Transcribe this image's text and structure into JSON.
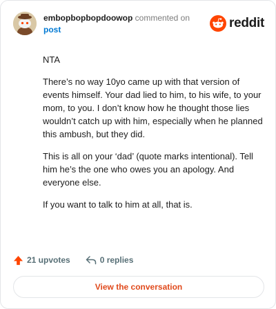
{
  "comment": {
    "author": "embopbopbopdoowop",
    "action": "commented on",
    "target": "post",
    "paragraphs": [
      "NTA",
      "There’s no way 10yo came up with that version of events himself. Your dad lied to him, to his wife, to your mom, to you. I don’t know how he thought those lies wouldn’t catch up with him, especially when he planned this ambush, but they did.",
      "This is all on your ‘dad’ (quote marks intentional). Tell him he’s the one who owes you an apology. And everyone else.",
      "If you want to talk to him at all, that is."
    ]
  },
  "brand": {
    "name": "reddit",
    "color": "#ff4500"
  },
  "footer": {
    "upvotes": "21 upvotes",
    "replies": "0 replies"
  },
  "cta": {
    "label": "View the conversation"
  }
}
